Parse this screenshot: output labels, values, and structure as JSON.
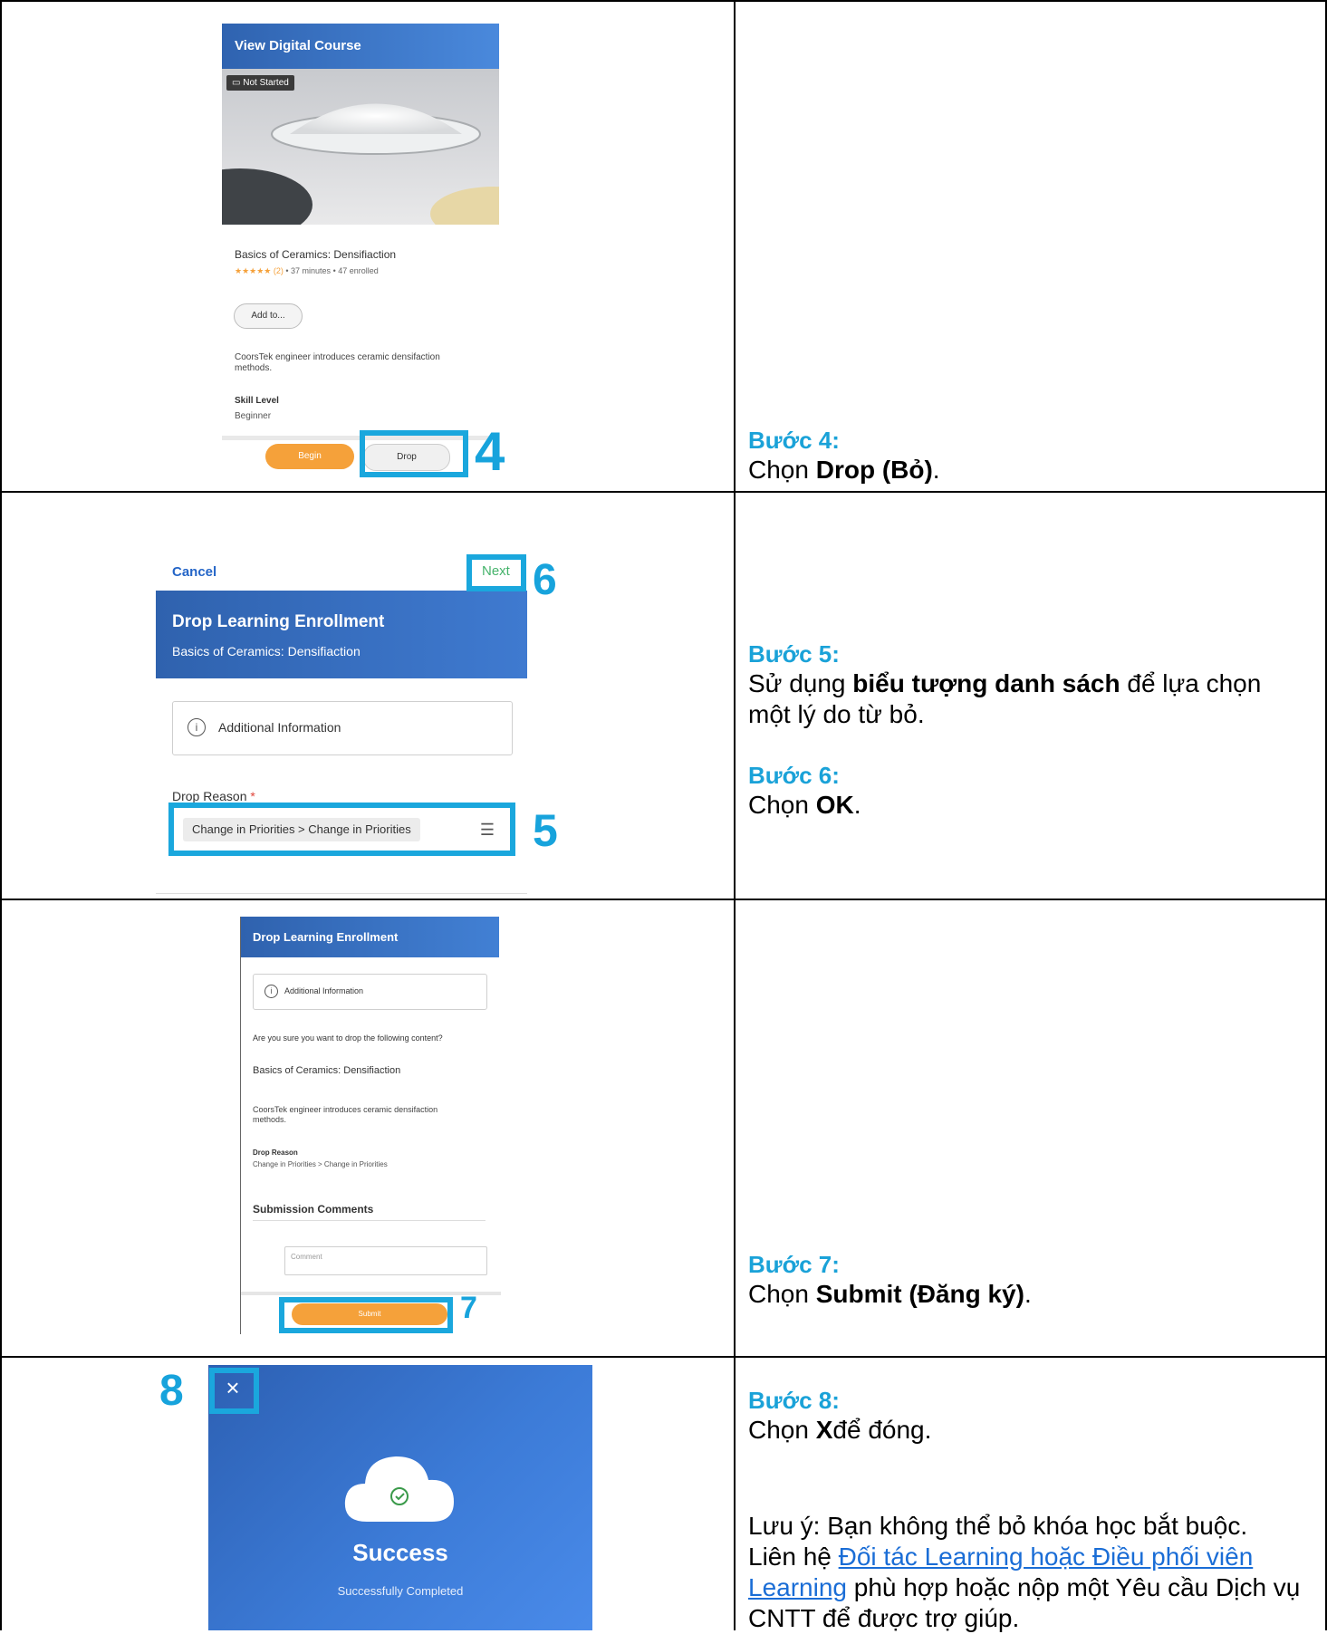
{
  "panel1": {
    "header_title": "View Digital Course",
    "status_badge": "Not Started",
    "course_title": "Basics of Ceramics: Densifiaction",
    "meta_rating": "★★★★★ (2)",
    "meta_duration": "37 minutes",
    "meta_enrolled": "47 enrolled",
    "add_to_label": "Add to...",
    "description": "CoorsTek engineer introduces ceramic densifaction methods.",
    "skill_level_label": "Skill Level",
    "skill_level_value": "Beginner",
    "begin_label": "Begin",
    "drop_label": "Drop",
    "callout_number": "4"
  },
  "panel2": {
    "cancel_label": "Cancel",
    "next_label": "Next",
    "callout_next": "6",
    "header_title": "Drop Learning Enrollment",
    "header_subtitle": "Basics of Ceramics: Densifiaction",
    "info_label": "Additional Information",
    "drop_reason_label": "Drop Reason",
    "required_mark": "*",
    "drop_reason_value": "Change in Priorities > Change in Priorities",
    "callout_reason": "5"
  },
  "panel3": {
    "header_title": "Drop Learning Enrollment",
    "info_label": "Additional Information",
    "confirm_question": "Are you sure you want to drop the following content?",
    "course_title": "Basics of Ceramics: Densifiaction",
    "description": "CoorsTek engineer introduces ceramic densifaction methods.",
    "drop_reason_label": "Drop Reason",
    "drop_reason_value": "Change in Priorities > Change in Priorities",
    "submission_comments": "Submission Comments",
    "comment_placeholder": "Comment",
    "submit_label": "Submit",
    "callout_number": "7"
  },
  "panel4": {
    "close_glyph": "×",
    "callout_number": "8",
    "success_title": "Success",
    "success_subtitle": "Successfully Completed"
  },
  "steps": {
    "s4_title": "Bước 4:",
    "s4_pre": "Chọn ",
    "s4_bold": "Drop (Bỏ)",
    "s4_post": ".",
    "s5_title": "Bước 5:",
    "s5_pre": "Sử dụng ",
    "s5_bold": "biểu tượng danh sách",
    "s5_post": " để lựa chọn một lý do từ bỏ.",
    "s6_title": "Bước 6:",
    "s6_pre": "Chọn ",
    "s6_bold": "OK",
    "s6_post": ".",
    "s7_title": "Bước 7:",
    "s7_pre": "Chọn ",
    "s7_bold": "Submit (Đăng ký)",
    "s7_post": ".",
    "s8_title": "Bước 8:",
    "s8_pre": "Chọn ",
    "s8_bold": "X",
    "s8_post": "để đóng.",
    "note_pre": "Lưu ý: Bạn không thể bỏ khóa học bắt buộc. Liên hệ ",
    "note_link": "Đối tác Learning hoặc Điều phối viên Learning",
    "note_post": " phù hợp hoặc nộp một Yêu cầu Dịch vụ CNTT để được trợ giúp."
  },
  "colors": {
    "accent_blue": "#1aa7dd",
    "header_blue": "#3a74c8",
    "orange": "#f5a13a",
    "link": "#1a6dd6"
  }
}
